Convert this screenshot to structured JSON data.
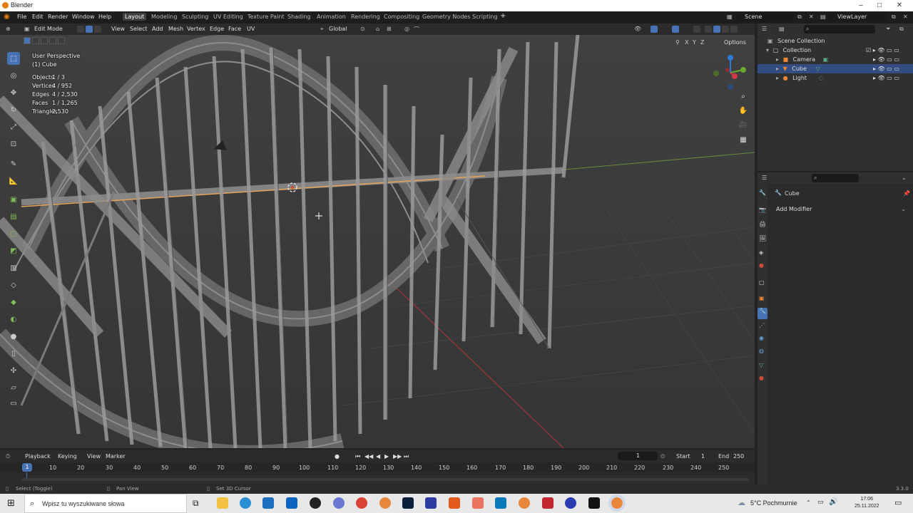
{
  "window": {
    "title": "Blender",
    "controls": [
      "–",
      "□",
      "✕"
    ]
  },
  "menu": {
    "items": [
      "File",
      "Edit",
      "Render",
      "Window",
      "Help"
    ]
  },
  "workspaces": [
    "Layout",
    "Modeling",
    "Sculpting",
    "UV Editing",
    "Texture Paint",
    "Shading",
    "Animation",
    "Rendering",
    "Compositing",
    "Geometry Nodes",
    "Scripting"
  ],
  "workspace_add": "+",
  "scene": {
    "scene_name": "Scene",
    "view_layer": "ViewLayer"
  },
  "viewport_header": {
    "mode": "Edit Mode",
    "menus": [
      "View",
      "Select",
      "Add",
      "Mesh",
      "Vertex",
      "Edge",
      "Face",
      "UV"
    ],
    "orientation": "Global"
  },
  "overlay": {
    "perspective": "User Perspective",
    "object": "(1) Cube",
    "stats": [
      {
        "label": "Objects",
        "value": "1 / 3"
      },
      {
        "label": "Vertices",
        "value": "4 / 952"
      },
      {
        "label": "Edges",
        "value": "4 / 2,530"
      },
      {
        "label": "Faces",
        "value": "1 / 1,265"
      },
      {
        "label": "Triangles",
        "value": "2,530"
      }
    ],
    "options_label": "Options",
    "axes": [
      "X",
      "Y",
      "Z"
    ]
  },
  "outliner": {
    "title": "Scene Collection",
    "rows": [
      {
        "label": "Collection",
        "selected": false
      },
      {
        "label": "Camera",
        "selected": false
      },
      {
        "label": "Cube",
        "selected": true
      },
      {
        "label": "Light",
        "selected": false
      }
    ]
  },
  "properties": {
    "object_name": "Cube",
    "add_modifier": "Add Modifier"
  },
  "timeline": {
    "menus": [
      "Playback",
      "Keying",
      "View",
      "Marker"
    ],
    "current_frame": "1",
    "start_label": "Start",
    "start": "1",
    "end_label": "End",
    "end": "250",
    "ticks": [
      "1",
      "10",
      "20",
      "30",
      "40",
      "50",
      "60",
      "70",
      "80",
      "90",
      "100",
      "110",
      "120",
      "130",
      "140",
      "150",
      "160",
      "170",
      "180",
      "190",
      "200",
      "210",
      "220",
      "230",
      "240",
      "250"
    ]
  },
  "statusbar": {
    "items": [
      "Select (Toggle)",
      "Pan View",
      "Set 3D Cursor"
    ],
    "version": "3.3.0"
  },
  "taskbar": {
    "search_placeholder": "Wpisz tu wyszukiwane słowa",
    "weather": "5°C  Pochmurnie",
    "time": "17:06",
    "date": "25.11.2022"
  },
  "colors": {
    "accent": "#4772b3",
    "selected_row": "#334d80",
    "orange": "#e87d0d"
  }
}
